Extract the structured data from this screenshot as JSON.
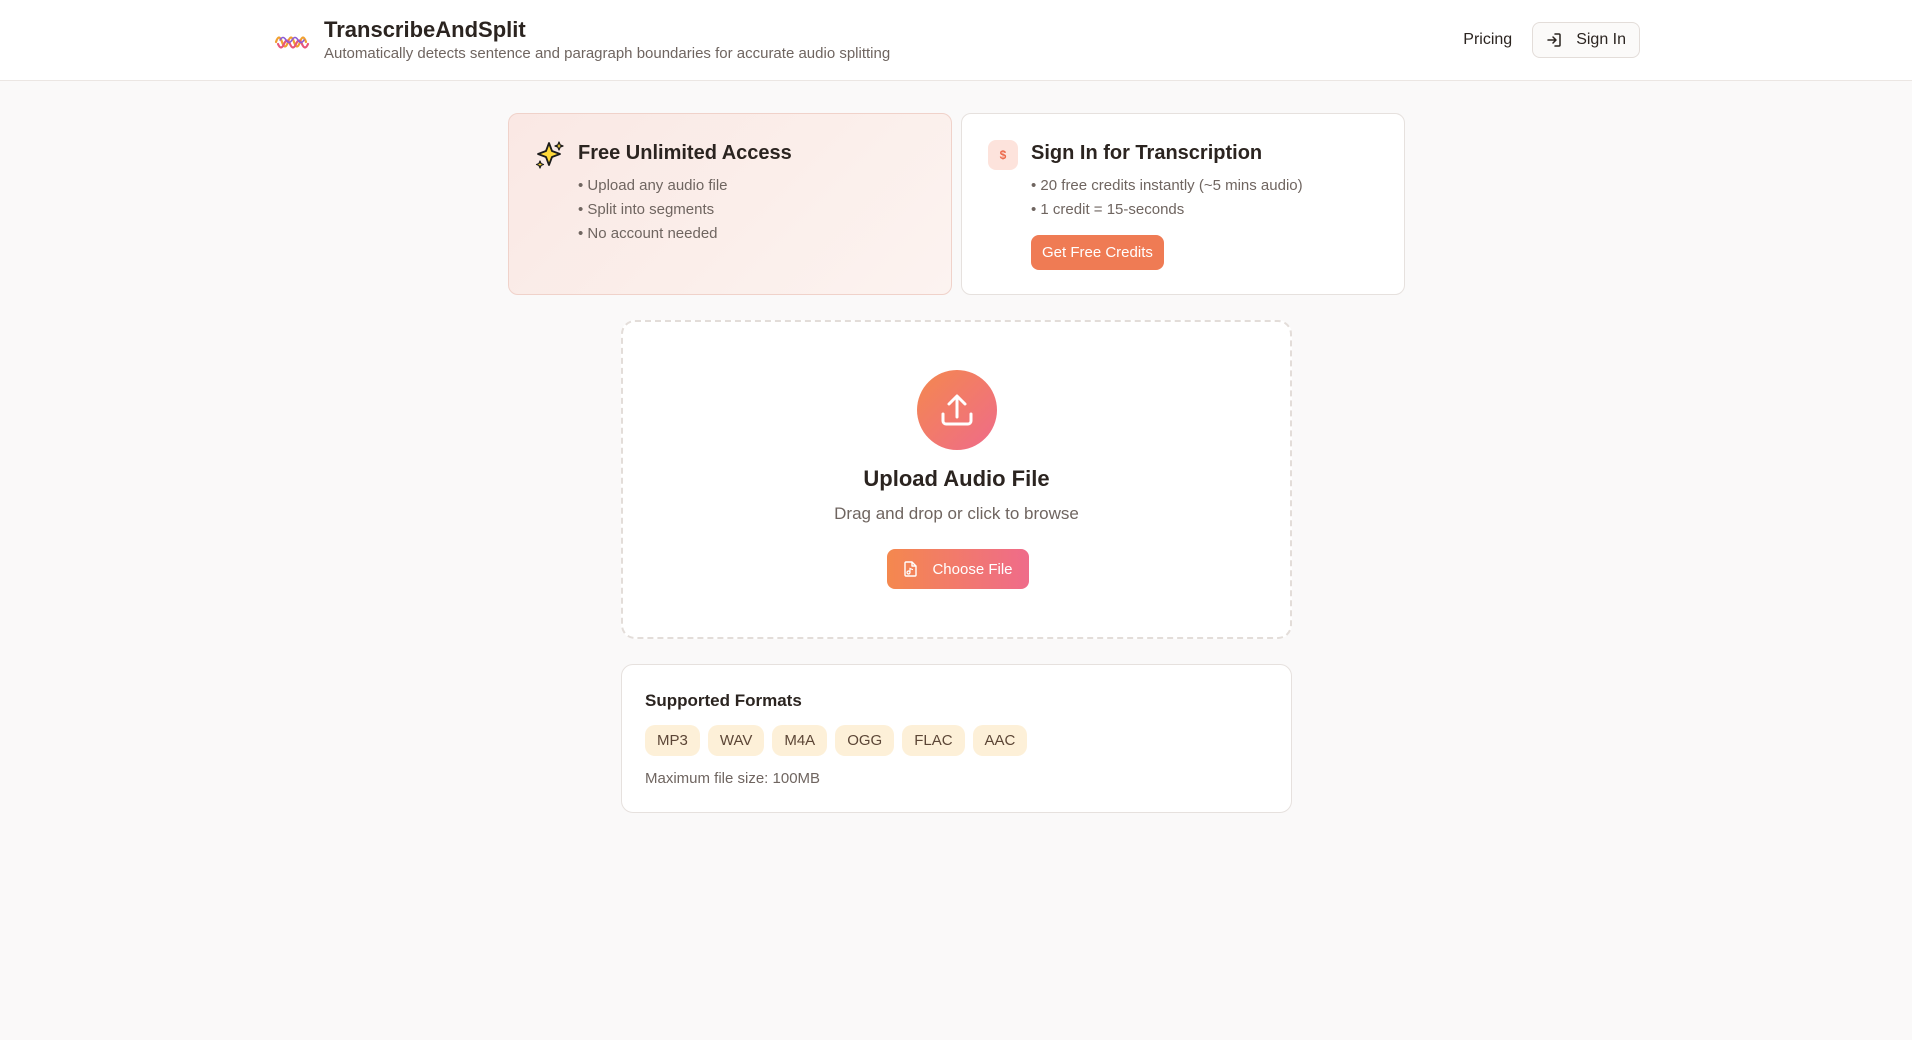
{
  "header": {
    "title": "TranscribeAndSplit",
    "subtitle": "Automatically detects sentence and paragraph boundaries for accurate audio splitting",
    "pricing_label": "Pricing",
    "signin_label": "Sign In"
  },
  "free_card": {
    "title": "Free Unlimited Access",
    "items": [
      "• Upload any audio file",
      "• Split into segments",
      "• No account needed"
    ]
  },
  "signin_card": {
    "badge": "$",
    "title": "Sign In for Transcription",
    "items": [
      "• 20 free credits instantly (~5 mins audio)",
      "• 1 credit = 15-seconds"
    ],
    "button_label": "Get Free Credits"
  },
  "upload": {
    "title": "Upload Audio File",
    "subtitle": "Drag and drop or click to browse",
    "button_label": "Choose File"
  },
  "formats": {
    "title": "Supported Formats",
    "list": [
      "MP3",
      "WAV",
      "M4A",
      "OGG",
      "FLAC",
      "AAC"
    ],
    "max_size": "Maximum file size: 100MB"
  },
  "icons": {
    "logo": "waveform-logo-icon",
    "signin": "login-arrow-icon",
    "free": "sparkles-icon",
    "upload": "upload-icon",
    "choose": "audio-file-icon"
  },
  "colors": {
    "accent_orange": "#ef7b54",
    "accent_pink": "#ef6b8a",
    "chip_bg": "#fdf0d8"
  }
}
